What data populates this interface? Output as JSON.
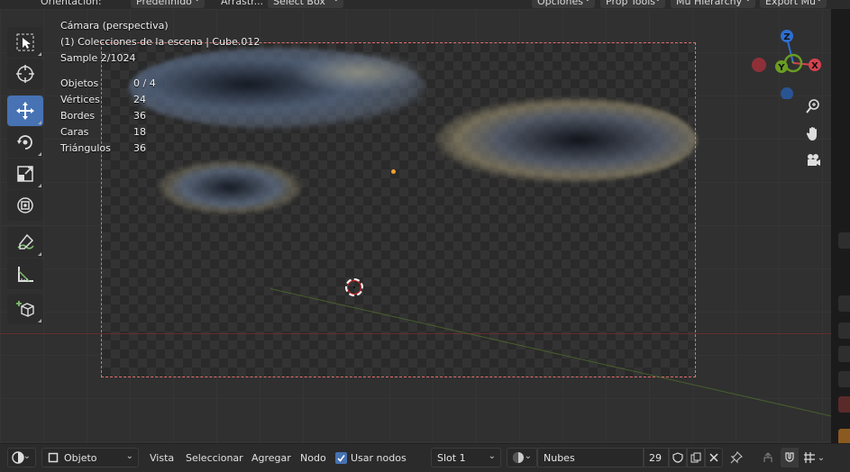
{
  "header": {
    "orientation_label": "Orientación:",
    "pivot_dropdown": "Predefinido",
    "drag_label": "Arrastr...",
    "select_dropdown": "Select Box",
    "options_dropdown": "Opciones",
    "prop_tools_dropdown": "Prop Tools",
    "mu_hierarchy_dropdown": "Mu Hierarchy",
    "export_dropdown": "Export Mu"
  },
  "overlay": {
    "view_name": "Cámara (perspectiva)",
    "collection_path": "(1) Colecciones de la escena | Cube.012",
    "sample": "Sample 2/1024",
    "stats": [
      {
        "label": "Objetos",
        "value": "0 / 4"
      },
      {
        "label": "Vértices",
        "value": "24"
      },
      {
        "label": "Bordes",
        "value": "36"
      },
      {
        "label": "Caras",
        "value": "18"
      },
      {
        "label": "Triángulos",
        "value": "36"
      }
    ]
  },
  "toolbar": {
    "tools": [
      "select-box-tool",
      "cursor-tool",
      "move-tool",
      "rotate-tool",
      "scale-tool",
      "transform-tool",
      "annotate-tool",
      "measure-tool",
      "add-cube-tool"
    ],
    "active_tool": "move-tool"
  },
  "gizmo": {
    "axis_z": "Z",
    "axis_y": "Y",
    "axis_x": "X",
    "colors": {
      "x": "#d3434f",
      "y": "#6a9d23",
      "z": "#2e6fd1"
    }
  },
  "bottombar": {
    "editor_mode": "Objeto",
    "menu_view": "Vista",
    "menu_select": "Seleccionar",
    "menu_add": "Agregar",
    "menu_node": "Nodo",
    "use_nodes_label": "Usar nodos",
    "use_nodes_checked": true,
    "slot": "Slot 1",
    "material_name": "Nubes",
    "user_count": "29"
  },
  "colors": {
    "active_tool": "#4772b3",
    "camera_frame": "#e76f6f",
    "origin_dot": "#f0a030"
  }
}
